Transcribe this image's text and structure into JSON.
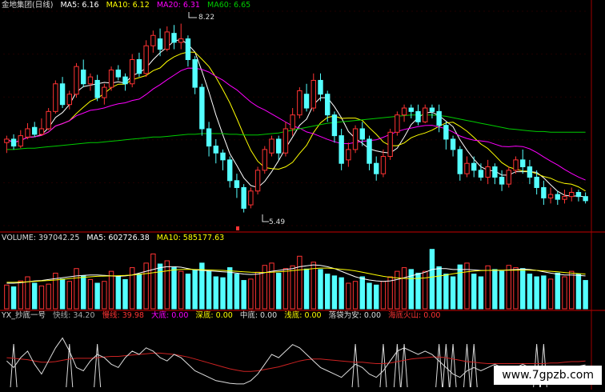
{
  "price_header": {
    "title": "金地集团(日线)",
    "ma5": "MA5: 6.16",
    "ma10": "MA10: 6.12",
    "ma20": "MA20: 6.31",
    "ma60": "MA60: 6.65"
  },
  "price_annotations": {
    "high": "8.22",
    "low": "5.49"
  },
  "volume_header": {
    "title": "VOLUME: 397042.25",
    "ma5": "MA5: 602726.38",
    "ma10": "MA10: 585177.63"
  },
  "indicator_header": {
    "title": "YX_抄底一号",
    "fast": "快线: 34.20",
    "slow": "慢线: 39.98",
    "big": "大底: 0.00",
    "deep": "深底: 0.00",
    "mid": "中底: 0.00",
    "shallow": "浅底: 0.00",
    "land": "落袋为安: 0.00",
    "peak": "海底火山: 0.00"
  },
  "watermark": "www.7gpzb.com",
  "colors": {
    "up": "#ff3333",
    "down": "#54ffff",
    "ma5": "#ffffff",
    "ma10": "#ffff00",
    "ma20": "#ff00ff",
    "ma60": "#00cc00",
    "divider": "#a00000",
    "slow_line": "#cc2222",
    "fast_line": "#dddddd"
  },
  "chart_data": [
    {
      "type": "candlestick",
      "title": "金地集团(日线)",
      "ylim": [
        5.3,
        8.4
      ],
      "high_label": 8.22,
      "low_label": 5.49,
      "candles": [
        [
          6.5,
          6.55,
          6.35,
          6.6
        ],
        [
          6.55,
          6.45,
          6.4,
          6.62
        ],
        [
          6.45,
          6.6,
          6.42,
          6.68
        ],
        [
          6.58,
          6.7,
          6.55,
          6.78
        ],
        [
          6.72,
          6.62,
          6.58,
          6.8
        ],
        [
          6.62,
          6.7,
          6.6,
          6.85
        ],
        [
          6.7,
          6.95,
          6.68,
          7.0
        ],
        [
          6.95,
          7.35,
          6.92,
          7.4
        ],
        [
          7.35,
          7.05,
          7.0,
          7.45
        ],
        [
          7.05,
          7.2,
          6.98,
          7.25
        ],
        [
          7.2,
          7.6,
          7.15,
          7.65
        ],
        [
          7.55,
          7.35,
          7.3,
          7.7
        ],
        [
          7.35,
          7.45,
          7.25,
          7.5
        ],
        [
          7.4,
          7.15,
          7.1,
          7.48
        ],
        [
          7.15,
          7.3,
          7.05,
          7.35
        ],
        [
          7.3,
          7.55,
          7.25,
          7.6
        ],
        [
          7.55,
          7.45,
          7.4,
          7.62
        ],
        [
          7.45,
          7.35,
          7.25,
          7.5
        ],
        [
          7.35,
          7.7,
          7.3,
          7.78
        ],
        [
          7.7,
          7.5,
          7.45,
          7.8
        ],
        [
          7.5,
          7.9,
          7.45,
          7.98
        ],
        [
          7.9,
          8.05,
          7.8,
          8.12
        ],
        [
          8.0,
          7.85,
          7.75,
          8.15
        ],
        [
          7.85,
          8.1,
          7.82,
          8.18
        ],
        [
          8.08,
          7.95,
          7.85,
          8.2
        ],
        [
          7.95,
          8.0,
          7.85,
          8.22
        ],
        [
          8.0,
          7.7,
          7.6,
          8.05
        ],
        [
          7.7,
          7.3,
          7.2,
          7.75
        ],
        [
          7.3,
          6.7,
          6.6,
          7.35
        ],
        [
          6.7,
          6.45,
          6.3,
          6.8
        ],
        [
          6.45,
          6.35,
          6.2,
          6.55
        ],
        [
          6.35,
          6.25,
          6.1,
          6.4
        ],
        [
          6.25,
          5.95,
          5.85,
          6.3
        ],
        [
          5.95,
          5.85,
          5.7,
          6.05
        ],
        [
          5.85,
          5.55,
          5.49,
          5.9
        ],
        [
          5.6,
          5.8,
          5.55,
          5.85
        ],
        [
          5.8,
          6.1,
          5.75,
          6.15
        ],
        [
          6.1,
          6.4,
          6.05,
          6.45
        ],
        [
          6.35,
          6.55,
          6.3,
          6.6
        ],
        [
          6.55,
          6.35,
          6.25,
          6.6
        ],
        [
          6.35,
          6.7,
          6.3,
          6.8
        ],
        [
          6.7,
          6.9,
          6.6,
          7.0
        ],
        [
          6.9,
          7.25,
          6.85,
          7.3
        ],
        [
          7.2,
          7.0,
          6.95,
          7.35
        ],
        [
          7.0,
          7.4,
          6.95,
          7.5
        ],
        [
          7.4,
          7.2,
          7.1,
          7.5
        ],
        [
          7.2,
          6.9,
          6.8,
          7.25
        ],
        [
          6.9,
          6.6,
          6.5,
          6.95
        ],
        [
          6.6,
          6.2,
          6.1,
          6.7
        ],
        [
          6.25,
          6.4,
          6.15,
          6.5
        ],
        [
          6.4,
          6.7,
          6.35,
          6.75
        ],
        [
          6.7,
          6.55,
          6.45,
          6.8
        ],
        [
          6.55,
          6.2,
          6.1,
          6.6
        ],
        [
          6.2,
          6.05,
          5.95,
          6.3
        ],
        [
          6.05,
          6.3,
          6.0,
          6.4
        ],
        [
          6.3,
          6.65,
          6.25,
          6.7
        ],
        [
          6.65,
          6.9,
          6.6,
          6.95
        ],
        [
          6.9,
          7.0,
          6.8,
          7.05
        ],
        [
          7.0,
          6.95,
          6.85,
          7.05
        ],
        [
          6.95,
          6.8,
          6.75,
          7.05
        ],
        [
          6.8,
          7.0,
          6.78,
          7.05
        ],
        [
          7.0,
          6.95,
          6.85,
          7.05
        ],
        [
          6.95,
          6.75,
          6.65,
          7.05
        ],
        [
          6.75,
          6.55,
          6.4,
          6.8
        ],
        [
          6.55,
          6.4,
          6.3,
          6.6
        ],
        [
          6.4,
          6.05,
          5.95,
          6.45
        ],
        [
          6.05,
          6.2,
          6.0,
          6.3
        ],
        [
          6.2,
          6.1,
          6.0,
          6.3
        ],
        [
          6.1,
          6.0,
          5.95,
          6.2
        ],
        [
          6.0,
          6.15,
          5.9,
          6.25
        ],
        [
          6.15,
          6.0,
          5.9,
          6.2
        ],
        [
          6.0,
          5.9,
          5.8,
          6.1
        ],
        [
          5.9,
          6.1,
          5.85,
          6.15
        ],
        [
          6.1,
          6.25,
          6.05,
          6.3
        ],
        [
          6.25,
          6.15,
          6.05,
          6.4
        ],
        [
          6.15,
          6.0,
          5.9,
          6.25
        ],
        [
          6.0,
          5.85,
          5.75,
          6.1
        ],
        [
          5.85,
          5.7,
          5.6,
          5.95
        ],
        [
          5.7,
          5.75,
          5.62,
          5.85
        ],
        [
          5.75,
          5.68,
          5.6,
          5.8
        ],
        [
          5.68,
          5.72,
          5.62,
          5.82
        ],
        [
          5.72,
          5.78,
          5.65,
          5.85
        ],
        [
          5.78,
          5.72,
          5.65,
          5.82
        ],
        [
          5.72,
          5.66,
          5.62,
          5.78
        ]
      ],
      "ma60": [
        6.4,
        6.4,
        6.41,
        6.42,
        6.42,
        6.43,
        6.44,
        6.45,
        6.46,
        6.47,
        6.48,
        6.49,
        6.5,
        6.5,
        6.51,
        6.52,
        6.53,
        6.54,
        6.55,
        6.56,
        6.57,
        6.58,
        6.58,
        6.59,
        6.6,
        6.61,
        6.62,
        6.62,
        6.63,
        6.63,
        6.63,
        6.63,
        6.62,
        6.62,
        6.61,
        6.61,
        6.61,
        6.62,
        6.63,
        6.64,
        6.66,
        6.68,
        6.7,
        6.72,
        6.74,
        6.76,
        6.78,
        6.79,
        6.8,
        6.81,
        6.82,
        6.83,
        6.84,
        6.85,
        6.86,
        6.87,
        6.88,
        6.89,
        6.9,
        6.9,
        6.9,
        6.9,
        6.89,
        6.88,
        6.86,
        6.84,
        6.82,
        6.8,
        6.78,
        6.76,
        6.74,
        6.72,
        6.7,
        6.69,
        6.68,
        6.67,
        6.66,
        6.66,
        6.65,
        6.65,
        6.65,
        6.65,
        6.65,
        6.65
      ]
    },
    {
      "type": "bar",
      "title": "VOLUME",
      "ylim": [
        0,
        1400000
      ],
      "values": [
        520000,
        480000,
        610000,
        700000,
        560000,
        500000,
        540000,
        780000,
        650000,
        600000,
        880000,
        720000,
        640000,
        560000,
        600000,
        820000,
        700000,
        640000,
        900000,
        760000,
        1000000,
        1200000,
        980000,
        1050000,
        900000,
        820000,
        760000,
        850000,
        1000000,
        820000,
        700000,
        680000,
        900000,
        760000,
        620000,
        650000,
        800000,
        950000,
        1000000,
        780000,
        880000,
        940000,
        1150000,
        870000,
        1020000,
        860000,
        760000,
        720000,
        680000,
        560000,
        600000,
        700000,
        560000,
        520000,
        600000,
        700000,
        820000,
        900000,
        860000,
        780000,
        820000,
        1300000,
        920000,
        760000,
        700000,
        960000,
        1000000,
        760000,
        700000,
        940000,
        860000,
        820000,
        950000,
        900000,
        880000,
        760000,
        700000,
        720000,
        650000,
        780000,
        700000,
        820000,
        760000,
        620000
      ],
      "ma5": [
        560000,
        560000,
        570000,
        590000,
        610000,
        620000,
        640000,
        660000,
        680000,
        700000,
        720000,
        730000,
        740000,
        740000,
        730000,
        720000,
        710000,
        720000,
        740000,
        780000,
        820000,
        860000,
        900000,
        920000,
        920000,
        910000,
        880000,
        850000,
        840000,
        830000,
        820000,
        810000,
        800000,
        780000,
        760000,
        750000,
        760000,
        790000,
        820000,
        840000,
        860000,
        880000,
        920000,
        940000,
        960000,
        950000,
        920000,
        880000,
        820000,
        760000,
        700000,
        660000,
        630000,
        610000,
        600000,
        610000,
        640000,
        680000,
        720000,
        760000,
        800000,
        860000,
        880000,
        880000,
        860000,
        860000,
        860000,
        850000,
        840000,
        840000,
        840000,
        840000,
        850000,
        860000,
        870000,
        860000,
        840000,
        810000,
        780000,
        760000,
        740000,
        740000,
        730000,
        720000
      ],
      "ma10": [
        580000,
        580000,
        585000,
        590000,
        600000,
        610000,
        620000,
        630000,
        645000,
        660000,
        675000,
        690000,
        700000,
        710000,
        715000,
        720000,
        725000,
        730000,
        740000,
        755000,
        770000,
        790000,
        810000,
        830000,
        850000,
        860000,
        865000,
        860000,
        855000,
        850000,
        845000,
        840000,
        830000,
        820000,
        810000,
        800000,
        795000,
        795000,
        800000,
        810000,
        820000,
        835000,
        850000,
        865000,
        880000,
        890000,
        890000,
        880000,
        865000,
        850000,
        830000,
        800000,
        770000,
        740000,
        710000,
        690000,
        675000,
        665000,
        660000,
        665000,
        675000,
        695000,
        715000,
        740000,
        765000,
        790000,
        810000,
        825000,
        835000,
        840000,
        845000,
        845000,
        845000,
        845000,
        845000,
        845000,
        840000,
        830000,
        820000,
        810000,
        795000,
        780000,
        770000,
        760000
      ]
    },
    {
      "type": "line",
      "title": "YX_抄底一号",
      "ylim": [
        0,
        100
      ],
      "fast": [
        40,
        30,
        45,
        55,
        35,
        20,
        40,
        60,
        75,
        55,
        30,
        25,
        40,
        50,
        45,
        35,
        30,
        45,
        55,
        50,
        60,
        55,
        45,
        40,
        50,
        45,
        35,
        25,
        20,
        15,
        10,
        8,
        6,
        5,
        5,
        10,
        20,
        35,
        50,
        45,
        55,
        65,
        60,
        50,
        40,
        30,
        25,
        20,
        15,
        25,
        35,
        30,
        20,
        15,
        25,
        40,
        55,
        60,
        55,
        50,
        55,
        50,
        40,
        30,
        20,
        15,
        25,
        30,
        25,
        30,
        35,
        30,
        25,
        30,
        35,
        30,
        20,
        15,
        15,
        20,
        25,
        30,
        32,
        34
      ],
      "slow": [
        45,
        44,
        43,
        42,
        40,
        38,
        38,
        39,
        41,
        43,
        44,
        44,
        44,
        45,
        46,
        47,
        47,
        48,
        49,
        50,
        51,
        52,
        52,
        51,
        50,
        48,
        46,
        43,
        40,
        37,
        34,
        31,
        28,
        26,
        24,
        24,
        25,
        27,
        29,
        31,
        34,
        37,
        40,
        42,
        43,
        43,
        42,
        41,
        40,
        39,
        38,
        38,
        37,
        36,
        36,
        37,
        39,
        41,
        43,
        44,
        45,
        46,
        46,
        45,
        43,
        41,
        39,
        38,
        37,
        36,
        36,
        36,
        36,
        36,
        36,
        36,
        36,
        36,
        37,
        37,
        38,
        39,
        39,
        40
      ],
      "spikes": [
        1,
        9,
        13,
        50,
        54,
        56,
        57,
        62,
        63,
        64,
        66,
        67,
        76,
        77,
        98,
        99
      ]
    }
  ]
}
